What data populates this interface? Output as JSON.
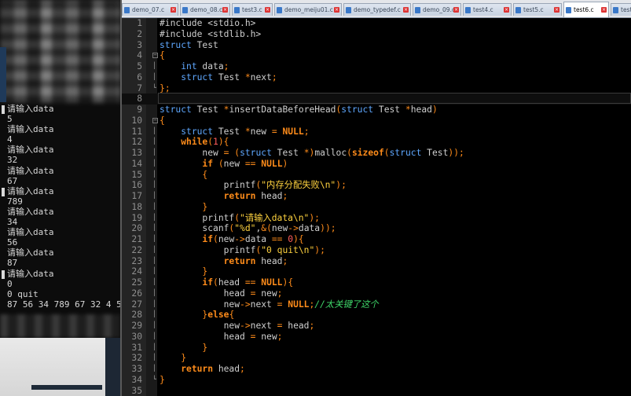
{
  "console": {
    "lines": [
      "请输入data",
      "5",
      "请输入data",
      "4",
      "请输入data",
      "32",
      "请输入data",
      "67",
      "请输入data",
      "789",
      "请输入data",
      "34",
      "请输入data",
      "56",
      "请输入data",
      "87",
      "请输入data",
      "0",
      "0 quit",
      "87 56 34 789 67 32 4 5"
    ]
  },
  "tabs": [
    {
      "label": "demo_07.c",
      "active": false
    },
    {
      "label": "demo_08.c",
      "active": false
    },
    {
      "label": "test3.c",
      "active": false
    },
    {
      "label": "demo_meiju01.c",
      "active": false
    },
    {
      "label": "demo_typedef.c",
      "active": false
    },
    {
      "label": "demo_09.c",
      "active": false
    },
    {
      "label": "test4.c",
      "active": false
    },
    {
      "label": "test5.c",
      "active": false
    },
    {
      "label": "test6.c",
      "active": true
    },
    {
      "label": "test7.c",
      "active": false
    }
  ],
  "icons": {
    "file": "file-icon",
    "close": "close-icon",
    "fold": "fold-marker-icon"
  },
  "colors": {
    "keyword": "#ff8c1a",
    "type": "#5fa8ff",
    "string": "#ffd33f",
    "number": "#ff5c5c",
    "comment": "#3fd86a",
    "text": "#cfcfcf",
    "line_number": "#8e8e8e"
  },
  "editor": {
    "current_line": 8,
    "lines": [
      {
        "n": "1",
        "text": "#include <stdio.h>"
      },
      {
        "n": "2",
        "text": "#include <stdlib.h>"
      },
      {
        "n": "3",
        "text": "struct Test"
      },
      {
        "n": "4",
        "text": "{"
      },
      {
        "n": "5",
        "text": "    int data;"
      },
      {
        "n": "6",
        "text": "    struct Test *next;"
      },
      {
        "n": "7",
        "text": "};"
      },
      {
        "n": "8",
        "text": ""
      },
      {
        "n": "9",
        "text": "struct Test *insertDataBeforeHead(struct Test *head)"
      },
      {
        "n": "10",
        "text": "{"
      },
      {
        "n": "11",
        "text": "    struct Test *new = NULL;"
      },
      {
        "n": "12",
        "text": "    while(1){"
      },
      {
        "n": "13",
        "text": "        new = (struct Test *)malloc(sizeof(struct Test));"
      },
      {
        "n": "14",
        "text": "        if (new == NULL)"
      },
      {
        "n": "15",
        "text": "        {"
      },
      {
        "n": "16",
        "text": "            printf(\"内存分配失败\\n\");"
      },
      {
        "n": "17",
        "text": "            return head;"
      },
      {
        "n": "18",
        "text": "        }"
      },
      {
        "n": "19",
        "text": "        printf(\"请输入data\\n\");"
      },
      {
        "n": "20",
        "text": "        scanf(\"%d\",&(new->data));"
      },
      {
        "n": "21",
        "text": "        if(new->data == 0){"
      },
      {
        "n": "22",
        "text": "            printf(\"0 quit\\n\");"
      },
      {
        "n": "23",
        "text": "            return head;"
      },
      {
        "n": "24",
        "text": "        }"
      },
      {
        "n": "25",
        "text": "        if(head == NULL){"
      },
      {
        "n": "26",
        "text": "            head = new;"
      },
      {
        "n": "27",
        "text": "            new->next = NULL;//太关键了这个"
      },
      {
        "n": "28",
        "text": "        }else{"
      },
      {
        "n": "29",
        "text": "            new->next = head;"
      },
      {
        "n": "30",
        "text": "            head = new;"
      },
      {
        "n": "31",
        "text": "        }"
      },
      {
        "n": "32",
        "text": "    }"
      },
      {
        "n": "33",
        "text": "    return head;"
      },
      {
        "n": "34",
        "text": "}"
      },
      {
        "n": "35",
        "text": ""
      }
    ]
  }
}
